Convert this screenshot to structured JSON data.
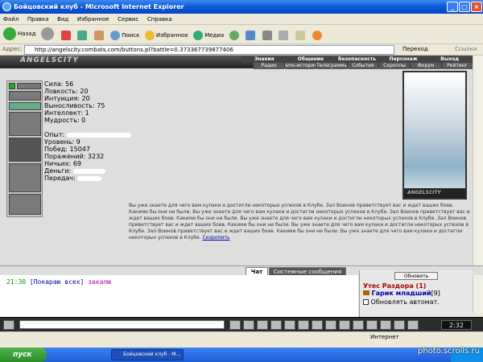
{
  "window": {
    "title": "Бойцовский клуб - Microsoft Internet Explorer"
  },
  "menu": [
    "Файл",
    "Правка",
    "Вид",
    "Избранное",
    "Сервис",
    "Справка"
  ],
  "toolbar": {
    "back": "Назад",
    "search": "Поиск",
    "favorites": "Избранное",
    "media": "Медиа"
  },
  "address": {
    "label": "Адрес:",
    "url": "http://angelscity.combats.com/buttons.pl?battle=0.373367739877406",
    "go": "Переход",
    "links": "Ссылки"
  },
  "game": {
    "logo": "ANGELSCITY",
    "nav_top": [
      "Знания",
      "Общение",
      "Безопасность",
      "Персонаж",
      "Выход"
    ],
    "nav_sub": [
      "Радио",
      "sms-история",
      "Телеграммы",
      "События",
      "Скроллы",
      "Форум",
      "Рейтинг"
    ],
    "stats": [
      {
        "label": "Сила: 56"
      },
      {
        "label": "Ловкость: 20"
      },
      {
        "label": "Интуиция: 20"
      },
      {
        "label": "Выносливость: 75"
      },
      {
        "label": "Интеллект: 1"
      },
      {
        "label": "Мудрость: 0"
      }
    ],
    "stats2": [
      {
        "label": "Опыт:"
      },
      {
        "label": "Уровень: 9"
      },
      {
        "label": "Побед: 15047"
      },
      {
        "label": "Поражений: 3232"
      },
      {
        "label": "Ничьих: 69"
      },
      {
        "label": "Деньги:"
      },
      {
        "label": "Передач:"
      }
    ],
    "portrait_caption": "ANGELSCITY",
    "news_text": "Вы уже знаете для чего вам кулаки и достигли некоторых успехов в Клубе. Зал Воинов приветствует вас и ждет ваших боев. Какими бы они ни были. Вы уже знаете для чего вам кулаки и достигли некоторых успехов в Клубе. Зал Воинов приветствует вас и ждет ваших боев. Какими бы они ни были. Вы уже знаете для чего вам кулаки и достигли некоторых успехов в Клубе. Зал Воинов приветствует вас и ждет ваших боев. Какими бы они ни были. Вы уже знаете для чего вам кулаки и достигли некоторых успехов в Клубе. Зал Воинов приветствует вас и ждет ваших боев. Какими бы они ни были. Вы уже знаете для чего вам кулаки и достигли некоторых успехов в Клубе.",
    "news_link": "Скоропить"
  },
  "tabs": {
    "chat": "Чат",
    "system": "Системные сообщения"
  },
  "chat": {
    "time": "21:30",
    "sender": "[Покараю всех]",
    "message": "закалю"
  },
  "online": {
    "refresh_button": "Обновить",
    "location": "Утес Раздора (1)",
    "player": "Гарик младший",
    "player_level": "[9]",
    "auto_refresh": "Обновлять автомат."
  },
  "status": {
    "zone": "Интернет"
  },
  "taskbar": {
    "start": "пуск",
    "task": "Бойцовский клуб - M...",
    "time": "2:32"
  },
  "watermark": "photo.scrolls.ru"
}
